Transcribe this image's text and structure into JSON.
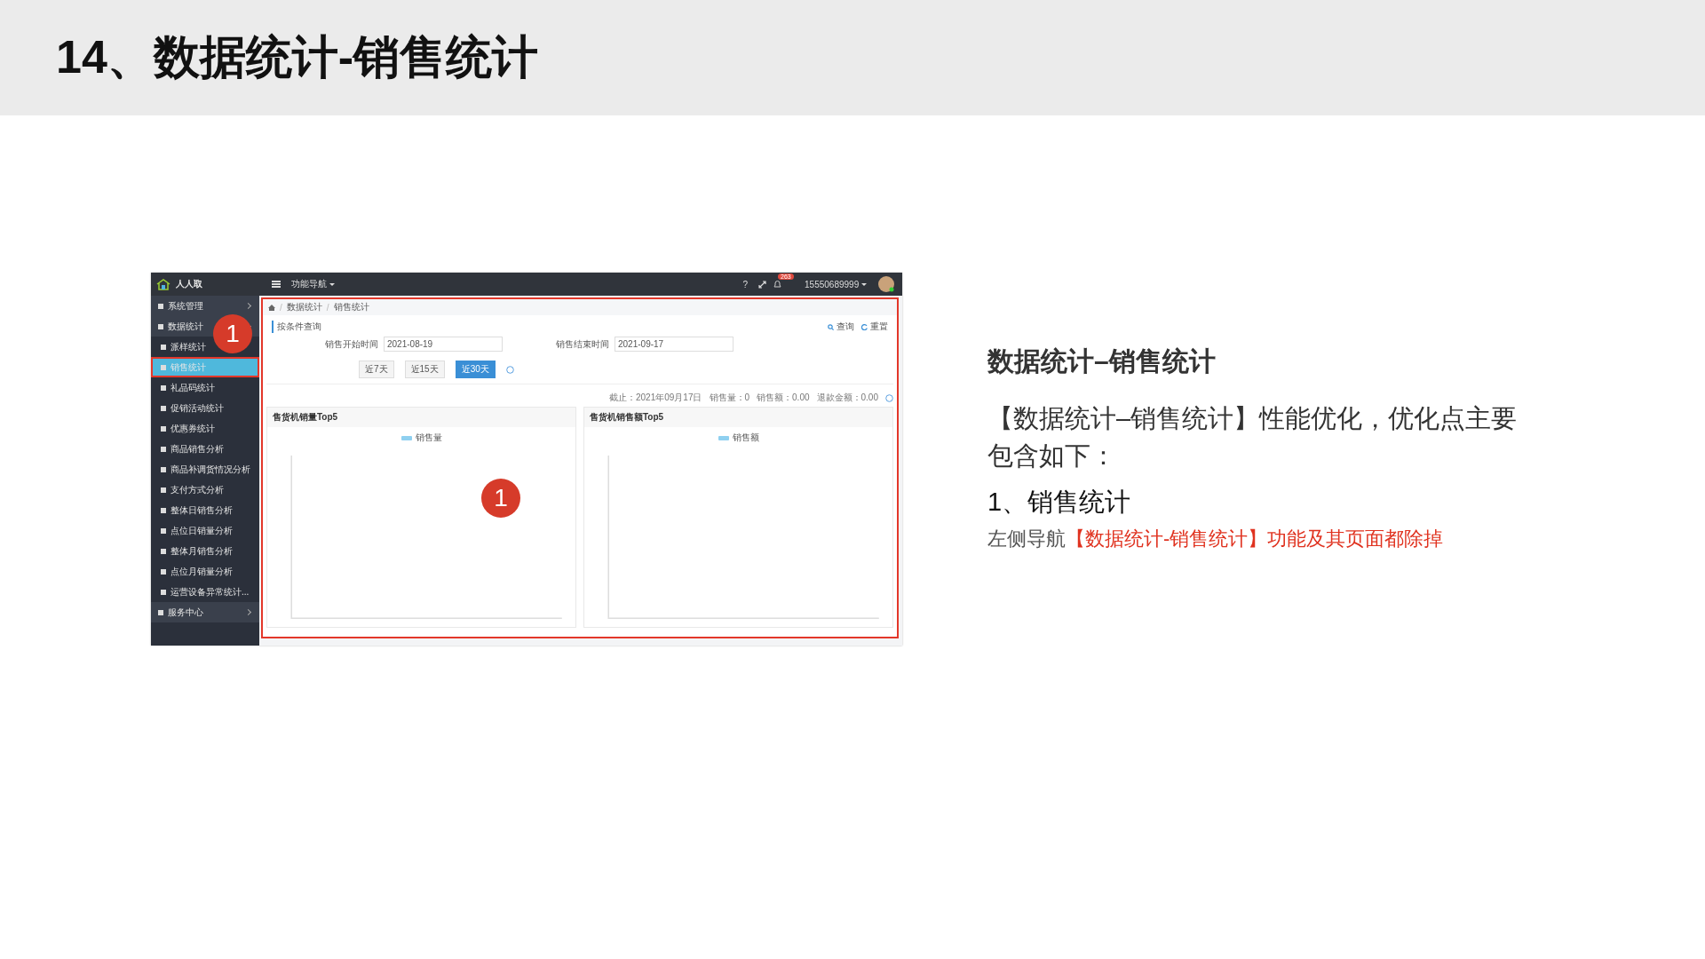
{
  "slide": {
    "title": "14、数据统计-销售统计"
  },
  "app": {
    "brand": "人人取",
    "nav_menu": "功能导航",
    "help": "?",
    "notifications": "263",
    "user": "15550689999",
    "sidebar": [
      {
        "label": "系统管理",
        "expanded": false
      },
      {
        "label": "数据统计",
        "expanded": true,
        "children": [
          {
            "label": "派样统计",
            "selected": false
          },
          {
            "label": "销售统计",
            "selected": true
          },
          {
            "label": "礼品码统计",
            "selected": false
          },
          {
            "label": "促销活动统计",
            "selected": false
          },
          {
            "label": "优惠券统计",
            "selected": false
          },
          {
            "label": "商品销售分析",
            "selected": false
          },
          {
            "label": "商品补调货情况分析",
            "selected": false
          },
          {
            "label": "支付方式分析",
            "selected": false
          },
          {
            "label": "整体日销售分析",
            "selected": false
          },
          {
            "label": "点位日销量分析",
            "selected": false
          },
          {
            "label": "整体月销售分析",
            "selected": false
          },
          {
            "label": "点位月销量分析",
            "selected": false
          },
          {
            "label": "运营设备异常统计...",
            "selected": false
          }
        ]
      },
      {
        "label": "服务中心",
        "expanded": false
      }
    ],
    "breadcrumb": [
      {
        "kind": "home"
      },
      {
        "kind": "sep",
        "text": "/"
      },
      {
        "kind": "link",
        "text": "数据统计"
      },
      {
        "kind": "sep",
        "text": "/"
      },
      {
        "kind": "link",
        "text": "销售统计"
      }
    ],
    "query": {
      "title": "按条件查询",
      "search": "查询",
      "reset": "重置",
      "fields": [
        {
          "label": "销售开始时间",
          "value": "2021-08-19"
        },
        {
          "label": "销售结束时间",
          "value": "2021-09-17"
        }
      ],
      "ranges": [
        {
          "label": "近7天",
          "selected": false
        },
        {
          "label": "近15天",
          "selected": false
        },
        {
          "label": "近30天",
          "selected": true
        }
      ]
    },
    "summary": [
      "截止：2021年09月17日",
      "销售量：0",
      "销售额：0.00",
      "退款金额：0.00"
    ],
    "charts": [
      {
        "title": "售货机销量Top5",
        "legend": "销售量"
      },
      {
        "title": "售货机销售额Top5",
        "legend": "销售额"
      }
    ],
    "annotations": [
      {
        "label": "1"
      },
      {
        "label": "1"
      }
    ]
  },
  "notes": {
    "heading": "数据统计–销售统计",
    "paragraph": "【数据统计–销售统计】性能优化，优化点主要包含如下：",
    "item": "1、销售统计",
    "detail": [
      {
        "text": "左侧导航",
        "highlight": false
      },
      {
        "text": "【数据统计-销售统计】功能及其页面都除掉",
        "highlight": true
      }
    ]
  }
}
